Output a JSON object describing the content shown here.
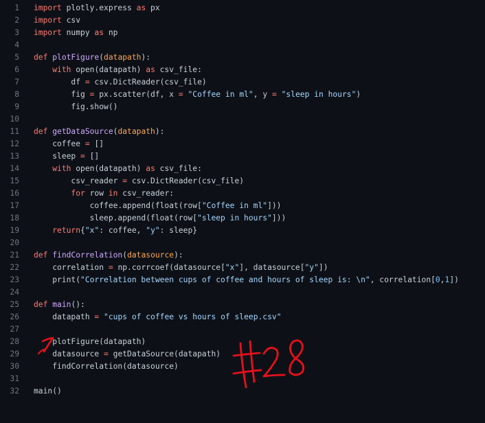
{
  "colors": {
    "background": "#0d1117",
    "line_number": "#6e7681",
    "plain": "#c9d1d9",
    "keyword": "#ff7b72",
    "function": "#d2a8ff",
    "string": "#a5d6ff",
    "parameter": "#ffa657",
    "number": "#79c0ff",
    "annotation_ink": "#e8101a"
  },
  "editor": {
    "lines": [
      {
        "n": "1",
        "tokens": [
          [
            "keyword",
            "import"
          ],
          [
            "plain",
            " plotly.express "
          ],
          [
            "keyword",
            "as"
          ],
          [
            "plain",
            " px"
          ]
        ]
      },
      {
        "n": "2",
        "tokens": [
          [
            "keyword",
            "import"
          ],
          [
            "plain",
            " csv"
          ]
        ]
      },
      {
        "n": "3",
        "tokens": [
          [
            "keyword",
            "import"
          ],
          [
            "plain",
            " numpy "
          ],
          [
            "keyword",
            "as"
          ],
          [
            "plain",
            " np"
          ]
        ]
      },
      {
        "n": "4",
        "tokens": []
      },
      {
        "n": "5",
        "tokens": [
          [
            "keyword",
            "def"
          ],
          [
            "plain",
            " "
          ],
          [
            "func",
            "plotFigure"
          ],
          [
            "plain",
            "("
          ],
          [
            "param",
            "datapath"
          ],
          [
            "plain",
            "):"
          ]
        ]
      },
      {
        "n": "6",
        "tokens": [
          [
            "plain",
            "    "
          ],
          [
            "keyword",
            "with"
          ],
          [
            "plain",
            " open(datapath) "
          ],
          [
            "keyword",
            "as"
          ],
          [
            "plain",
            " csv_file:"
          ]
        ]
      },
      {
        "n": "7",
        "tokens": [
          [
            "plain",
            "        df "
          ],
          [
            "op",
            "="
          ],
          [
            "plain",
            " csv.DictReader(csv_file)"
          ]
        ]
      },
      {
        "n": "8",
        "tokens": [
          [
            "plain",
            "        fig "
          ],
          [
            "op",
            "="
          ],
          [
            "plain",
            " px.scatter(df, x "
          ],
          [
            "op",
            "="
          ],
          [
            "plain",
            " "
          ],
          [
            "string",
            "\"Coffee in ml\""
          ],
          [
            "plain",
            ", y "
          ],
          [
            "op",
            "="
          ],
          [
            "plain",
            " "
          ],
          [
            "string",
            "\"sleep in hours\""
          ],
          [
            "plain",
            ")"
          ]
        ]
      },
      {
        "n": "9",
        "tokens": [
          [
            "plain",
            "        fig.show()"
          ]
        ]
      },
      {
        "n": "10",
        "tokens": []
      },
      {
        "n": "11",
        "tokens": [
          [
            "keyword",
            "def"
          ],
          [
            "plain",
            " "
          ],
          [
            "func",
            "getDataSource"
          ],
          [
            "plain",
            "("
          ],
          [
            "param",
            "datapath"
          ],
          [
            "plain",
            "):"
          ]
        ]
      },
      {
        "n": "12",
        "tokens": [
          [
            "plain",
            "    coffee "
          ],
          [
            "op",
            "="
          ],
          [
            "plain",
            " []"
          ]
        ]
      },
      {
        "n": "13",
        "tokens": [
          [
            "plain",
            "    sleep "
          ],
          [
            "op",
            "="
          ],
          [
            "plain",
            " []"
          ]
        ]
      },
      {
        "n": "14",
        "tokens": [
          [
            "plain",
            "    "
          ],
          [
            "keyword",
            "with"
          ],
          [
            "plain",
            " open(datapath) "
          ],
          [
            "keyword",
            "as"
          ],
          [
            "plain",
            " csv_file:"
          ]
        ]
      },
      {
        "n": "15",
        "tokens": [
          [
            "plain",
            "        csv_reader "
          ],
          [
            "op",
            "="
          ],
          [
            "plain",
            " csv.DictReader(csv_file)"
          ]
        ]
      },
      {
        "n": "16",
        "tokens": [
          [
            "plain",
            "        "
          ],
          [
            "keyword",
            "for"
          ],
          [
            "plain",
            " row "
          ],
          [
            "keyword",
            "in"
          ],
          [
            "plain",
            " csv_reader:"
          ]
        ]
      },
      {
        "n": "17",
        "tokens": [
          [
            "plain",
            "            coffee.append(float(row["
          ],
          [
            "string",
            "\"Coffee in ml\""
          ],
          [
            "plain",
            "]))"
          ]
        ]
      },
      {
        "n": "18",
        "tokens": [
          [
            "plain",
            "            sleep.append(float(row["
          ],
          [
            "string",
            "\"sleep in hours\""
          ],
          [
            "plain",
            "]))"
          ]
        ]
      },
      {
        "n": "19",
        "tokens": [
          [
            "plain",
            "    "
          ],
          [
            "keyword",
            "return"
          ],
          [
            "plain",
            "{"
          ],
          [
            "string",
            "\"x\""
          ],
          [
            "plain",
            ": coffee, "
          ],
          [
            "string",
            "\"y\""
          ],
          [
            "plain",
            ": sleep}"
          ]
        ]
      },
      {
        "n": "20",
        "tokens": []
      },
      {
        "n": "21",
        "tokens": [
          [
            "keyword",
            "def"
          ],
          [
            "plain",
            " "
          ],
          [
            "func",
            "findCorrelation"
          ],
          [
            "plain",
            "("
          ],
          [
            "param",
            "datasource"
          ],
          [
            "plain",
            "):"
          ]
        ]
      },
      {
        "n": "22",
        "tokens": [
          [
            "plain",
            "    correlation "
          ],
          [
            "op",
            "="
          ],
          [
            "plain",
            " np.corrcoef(datasource["
          ],
          [
            "string",
            "\"x\""
          ],
          [
            "plain",
            "], datasource["
          ],
          [
            "string",
            "\"y\""
          ],
          [
            "plain",
            "])"
          ]
        ]
      },
      {
        "n": "23",
        "tokens": [
          [
            "plain",
            "    print("
          ],
          [
            "string",
            "\"Correlation between cups of coffee and hours of sleep is: \\n\""
          ],
          [
            "plain",
            ", correlation["
          ],
          [
            "number",
            "0"
          ],
          [
            "plain",
            ","
          ],
          [
            "number",
            "1"
          ],
          [
            "plain",
            "])"
          ]
        ]
      },
      {
        "n": "24",
        "tokens": []
      },
      {
        "n": "25",
        "tokens": [
          [
            "keyword",
            "def"
          ],
          [
            "plain",
            " "
          ],
          [
            "func",
            "main"
          ],
          [
            "plain",
            "():"
          ]
        ]
      },
      {
        "n": "26",
        "tokens": [
          [
            "plain",
            "    datapath "
          ],
          [
            "op",
            "="
          ],
          [
            "plain",
            " "
          ],
          [
            "string",
            "\"cups of coffee vs hours of sleep.csv\""
          ]
        ]
      },
      {
        "n": "27",
        "tokens": []
      },
      {
        "n": "28",
        "tokens": [
          [
            "plain",
            "    plotFigure(datapath)"
          ]
        ]
      },
      {
        "n": "29",
        "tokens": [
          [
            "plain",
            "    datasource "
          ],
          [
            "op",
            "="
          ],
          [
            "plain",
            " getDataSource(datapath)"
          ]
        ]
      },
      {
        "n": "30",
        "tokens": [
          [
            "plain",
            "    findCorrelation(datasource)"
          ]
        ]
      },
      {
        "n": "31",
        "tokens": []
      },
      {
        "n": "32",
        "tokens": [
          [
            "plain",
            "main()"
          ]
        ]
      }
    ]
  },
  "annotation": {
    "label": "#28"
  }
}
